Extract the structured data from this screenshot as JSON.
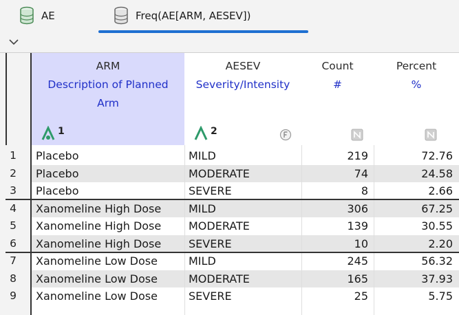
{
  "tabs": [
    {
      "label": "AE",
      "icon": "data-table-icon"
    },
    {
      "label": "Freq(AE[ARM, AESEV])",
      "icon": "data-table-icon",
      "active": true
    }
  ],
  "columns": [
    {
      "name": "ARM",
      "label_lines": [
        "Description of Planned",
        "Arm"
      ],
      "role_index": "1",
      "selected": true
    },
    {
      "name": "AESEV",
      "label_lines": [
        "Severity/Intensity"
      ],
      "role_index": "2"
    },
    {
      "name": "Count",
      "label_lines": [
        "#"
      ]
    },
    {
      "name": "Percent",
      "label_lines": [
        "%"
      ]
    }
  ],
  "rows": [
    {
      "n": "1",
      "arm": "Placebo",
      "sev": "MILD",
      "count": "219",
      "pct": "72.76"
    },
    {
      "n": "2",
      "arm": "Placebo",
      "sev": "MODERATE",
      "count": "74",
      "pct": "24.58"
    },
    {
      "n": "3",
      "arm": "Placebo",
      "sev": "SEVERE",
      "count": "8",
      "pct": "2.66"
    },
    {
      "n": "4",
      "arm": "Xanomeline High Dose",
      "sev": "MILD",
      "count": "306",
      "pct": "67.25"
    },
    {
      "n": "5",
      "arm": "Xanomeline High Dose",
      "sev": "MODERATE",
      "count": "139",
      "pct": "30.55"
    },
    {
      "n": "6",
      "arm": "Xanomeline High Dose",
      "sev": "SEVERE",
      "count": "10",
      "pct": "2.20"
    },
    {
      "n": "7",
      "arm": "Xanomeline Low Dose",
      "sev": "MILD",
      "count": "245",
      "pct": "56.32"
    },
    {
      "n": "8",
      "arm": "Xanomeline Low Dose",
      "sev": "MODERATE",
      "count": "165",
      "pct": "37.93"
    },
    {
      "n": "9",
      "arm": "Xanomeline Low Dose",
      "sev": "SEVERE",
      "count": "25",
      "pct": "5.75"
    }
  ],
  "colors": {
    "accent": "#1e6fd1",
    "selected_header": "#d9dafc",
    "label_text": "#2030c8",
    "role_icon": "#2e9a6a"
  }
}
